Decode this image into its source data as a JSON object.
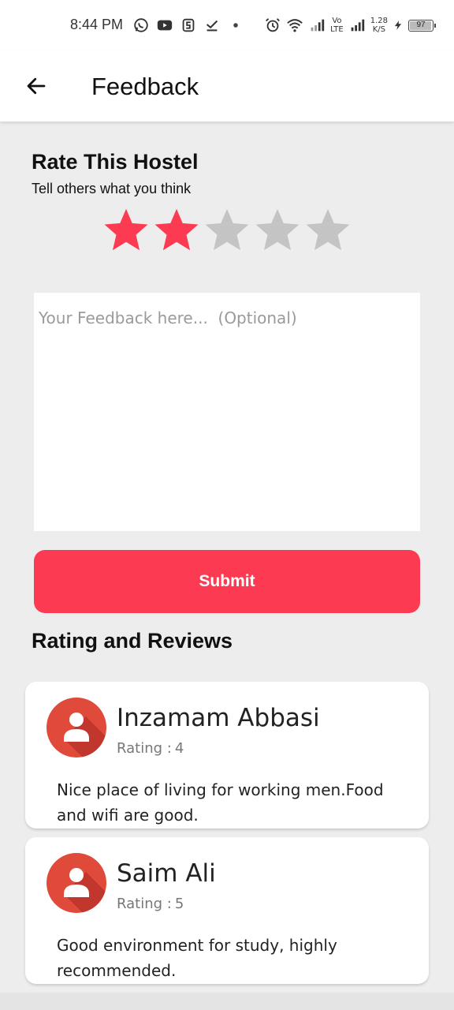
{
  "status_bar": {
    "time": "8:44 PM",
    "left_icons": [
      "whatsapp-icon",
      "youtube-icon",
      "s-app-icon",
      "download-done-icon",
      "dot-icon"
    ],
    "net_speed_value": "1.28",
    "net_speed_unit": "K/S",
    "lte_top": "Vo",
    "lte_bottom": "LTE",
    "battery": "97",
    "battery_level": 0.97
  },
  "app_bar": {
    "title": "Feedback",
    "back_icon": "arrow-back-icon"
  },
  "rating_section": {
    "title": "Rate This Hostel",
    "subtitle": "Tell others what you think",
    "max_stars": 5,
    "selected_stars": 2,
    "active_color": "#fc3a52",
    "inactive_color": "#c4c4c4"
  },
  "feedback": {
    "placeholder": "Your Feedback here...  (Optional)",
    "value": ""
  },
  "submit_label": "Submit",
  "reviews_section": {
    "title": "Rating and Reviews",
    "rating_label": "Rating :",
    "reviews": [
      {
        "name": "Inzamam Abbasi",
        "rating": "4",
        "text": "Nice place of living for working men.Food and wifi are good."
      },
      {
        "name": "Saim Ali",
        "rating": "5",
        "text": "Good environment for study, highly recommended."
      }
    ]
  },
  "colors": {
    "accent": "#fc3a52",
    "avatar": "#e04a3a",
    "background": "#ededed"
  }
}
